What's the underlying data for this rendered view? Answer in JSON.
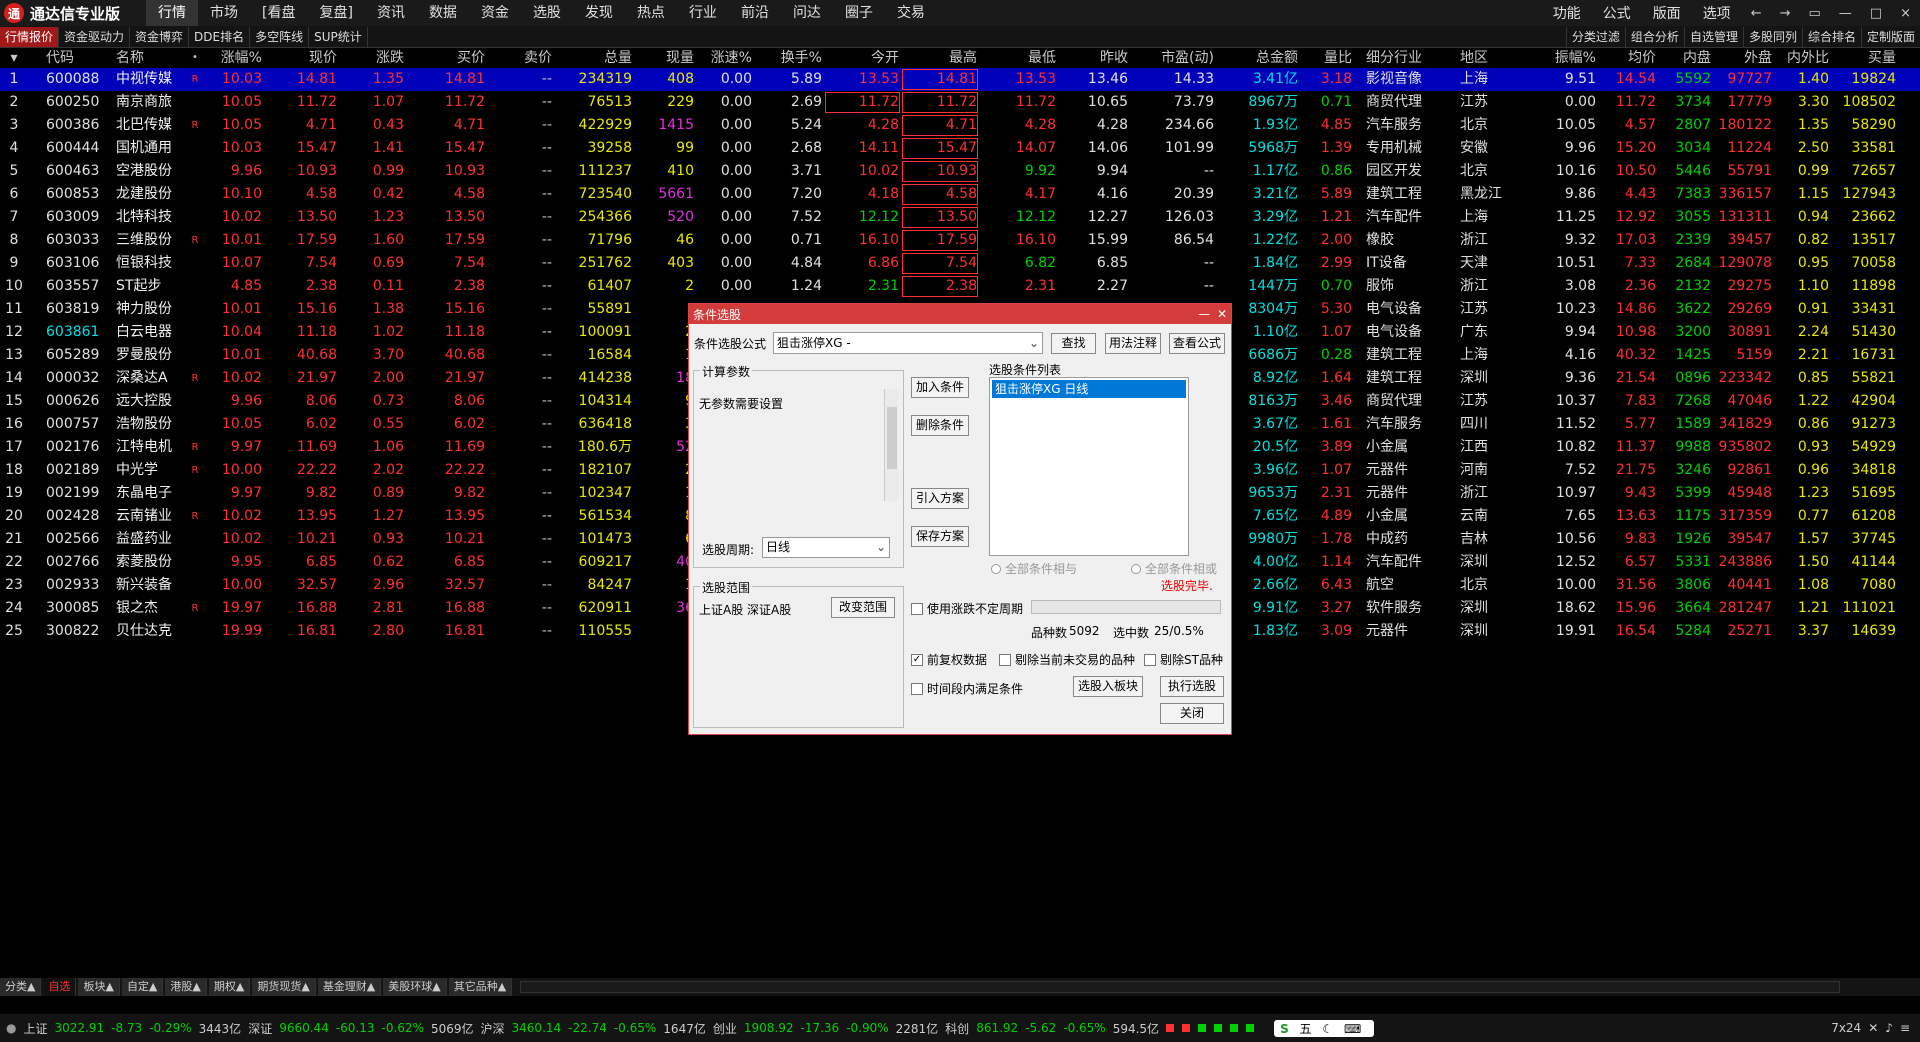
{
  "app": {
    "title": "通达信专业版",
    "logo_char": "通"
  },
  "menu": [
    "行情",
    "市场",
    "[看盘",
    "复盘]",
    "资讯",
    "数据",
    "资金",
    "选股",
    "发现",
    "热点",
    "行业",
    "前沿",
    "问达",
    "圈子",
    "交易"
  ],
  "menu_active": 0,
  "top_right": [
    "功能",
    "公式",
    "版面",
    "选项"
  ],
  "window_controls": [
    "←",
    "→",
    "▭",
    "—",
    "□",
    "×"
  ],
  "subtabs_left": [
    "行情报价",
    "资金驱动力",
    "资金博弈",
    "DDE排名",
    "多空阵线",
    "SUP统计"
  ],
  "subtabs_right": [
    "分类过滤",
    "组合分析",
    "自选管理",
    "多股同列",
    "综合排名",
    "定制版面"
  ],
  "columns": [
    "",
    "代码",
    "名称",
    "•",
    "涨幅%",
    "现价",
    "涨跌",
    "买价",
    "卖价",
    "总量",
    "现量",
    "涨速%",
    "换手%",
    "今开",
    "最高",
    "最低",
    "昨收",
    "市盈(动)",
    "总金额",
    "量比",
    "细分行业",
    "地区",
    "振幅%",
    "均价",
    "内盘",
    "外盘",
    "内外比",
    "买量"
  ],
  "rows": [
    {
      "idx": "1",
      "code": "600088",
      "name": "中视传媒",
      "flag": "R",
      "pct": "10.03",
      "price": "14.81",
      "chg": "1.35",
      "bid": "14.81",
      "ask": "--",
      "vol": "234319",
      "cur": "408",
      "spd": "0.00",
      "turn": "5.89",
      "open": "13.53",
      "high": "14.81",
      "low": "13.53",
      "prev": "13.46",
      "pe": "14.33",
      "amt": "3.41亿",
      "vr": "3.18",
      "ind": "影视音像",
      "reg": "上海",
      "amp": "9.51",
      "avg": "14.54",
      "in": "5592",
      "out": "97727",
      "io": "1.40",
      "buy": "19824"
    },
    {
      "idx": "2",
      "code": "600250",
      "name": "南京商旅",
      "flag": "",
      "pct": "10.05",
      "price": "11.72",
      "chg": "1.07",
      "bid": "11.72",
      "ask": "--",
      "vol": "76513",
      "cur": "229",
      "spd": "0.00",
      "turn": "2.69",
      "open": "11.72",
      "high": "11.72",
      "low": "11.72",
      "prev": "10.65",
      "pe": "73.79",
      "amt": "8967万",
      "vr": "0.71",
      "ind": "商贸代理",
      "reg": "江苏",
      "amp": "0.00",
      "avg": "11.72",
      "in": "3734",
      "out": "17779",
      "io": "3.30",
      "buy": "108502"
    },
    {
      "idx": "3",
      "code": "600386",
      "name": "北巴传媒",
      "flag": "R",
      "pct": "10.05",
      "price": "4.71",
      "chg": "0.43",
      "bid": "4.71",
      "ask": "--",
      "vol": "422929",
      "cur": "1415",
      "spd": "0.00",
      "turn": "5.24",
      "open": "4.28",
      "high": "4.71",
      "low": "4.28",
      "prev": "4.28",
      "pe": "234.66",
      "amt": "1.93亿",
      "vr": "4.85",
      "ind": "汽车服务",
      "reg": "北京",
      "amp": "10.05",
      "avg": "4.57",
      "in": "2807",
      "out": "180122",
      "io": "1.35",
      "buy": "58290"
    },
    {
      "idx": "4",
      "code": "600444",
      "name": "国机通用",
      "flag": "",
      "pct": "10.03",
      "price": "15.47",
      "chg": "1.41",
      "bid": "15.47",
      "ask": "--",
      "vol": "39258",
      "cur": "99",
      "spd": "0.00",
      "turn": "2.68",
      "open": "14.11",
      "high": "15.47",
      "low": "14.07",
      "prev": "14.06",
      "pe": "101.99",
      "amt": "5968万",
      "vr": "1.39",
      "ind": "专用机械",
      "reg": "安徽",
      "amp": "9.96",
      "avg": "15.20",
      "in": "3034",
      "out": "11224",
      "io": "2.50",
      "buy": "33581"
    },
    {
      "idx": "5",
      "code": "600463",
      "name": "空港股份",
      "flag": "",
      "pct": "9.96",
      "price": "10.93",
      "chg": "0.99",
      "bid": "10.93",
      "ask": "--",
      "vol": "111237",
      "cur": "410",
      "spd": "0.00",
      "turn": "3.71",
      "open": "10.02",
      "high": "10.93",
      "low": "9.92",
      "prev": "9.94",
      "pe": "--",
      "amt": "1.17亿",
      "vr": "0.86",
      "ind": "园区开发",
      "reg": "北京",
      "amp": "10.16",
      "avg": "10.50",
      "in": "5446",
      "out": "55791",
      "io": "0.99",
      "buy": "72657"
    },
    {
      "idx": "6",
      "code": "600853",
      "name": "龙建股份",
      "flag": "",
      "pct": "10.10",
      "price": "4.58",
      "chg": "0.42",
      "bid": "4.58",
      "ask": "--",
      "vol": "723540",
      "cur": "5661",
      "spd": "0.00",
      "turn": "7.20",
      "open": "4.18",
      "high": "4.58",
      "low": "4.17",
      "prev": "4.16",
      "pe": "20.39",
      "amt": "3.21亿",
      "vr": "5.89",
      "ind": "建筑工程",
      "reg": "黑龙江",
      "amp": "9.86",
      "avg": "4.43",
      "in": "7383",
      "out": "336157",
      "io": "1.15",
      "buy": "127943"
    },
    {
      "idx": "7",
      "code": "603009",
      "name": "北特科技",
      "flag": "",
      "pct": "10.02",
      "price": "13.50",
      "chg": "1.23",
      "bid": "13.50",
      "ask": "--",
      "vol": "254366",
      "cur": "520",
      "spd": "0.00",
      "turn": "7.52",
      "open": "12.12",
      "high": "13.50",
      "low": "12.12",
      "prev": "12.27",
      "pe": "126.03",
      "amt": "3.29亿",
      "vr": "1.21",
      "ind": "汽车配件",
      "reg": "上海",
      "amp": "11.25",
      "avg": "12.92",
      "in": "3055",
      "out": "131311",
      "io": "0.94",
      "buy": "23662"
    },
    {
      "idx": "8",
      "code": "603033",
      "name": "三维股份",
      "flag": "R",
      "pct": "10.01",
      "price": "17.59",
      "chg": "1.60",
      "bid": "17.59",
      "ask": "--",
      "vol": "71796",
      "cur": "46",
      "spd": "0.00",
      "turn": "0.71",
      "open": "16.10",
      "high": "17.59",
      "low": "16.10",
      "prev": "15.99",
      "pe": "86.54",
      "amt": "1.22亿",
      "vr": "2.00",
      "ind": "橡胶",
      "reg": "浙江",
      "amp": "9.32",
      "avg": "17.03",
      "in": "2339",
      "out": "39457",
      "io": "0.82",
      "buy": "13517"
    },
    {
      "idx": "9",
      "code": "603106",
      "name": "恒银科技",
      "flag": "",
      "pct": "10.07",
      "price": "7.54",
      "chg": "0.69",
      "bid": "7.54",
      "ask": "--",
      "vol": "251762",
      "cur": "403",
      "spd": "0.00",
      "turn": "4.84",
      "open": "6.86",
      "high": "7.54",
      "low": "6.82",
      "prev": "6.85",
      "pe": "--",
      "amt": "1.84亿",
      "vr": "2.99",
      "ind": "IT设备",
      "reg": "天津",
      "amp": "10.51",
      "avg": "7.33",
      "in": "2684",
      "out": "129078",
      "io": "0.95",
      "buy": "70058"
    },
    {
      "idx": "10",
      "code": "603557",
      "name": "ST起步",
      "flag": "",
      "pct": "4.85",
      "price": "2.38",
      "chg": "0.11",
      "bid": "2.38",
      "ask": "--",
      "vol": "61407",
      "cur": "2",
      "spd": "0.00",
      "turn": "1.24",
      "open": "2.31",
      "high": "2.38",
      "low": "2.31",
      "prev": "2.27",
      "pe": "--",
      "amt": "1447万",
      "vr": "0.70",
      "ind": "服饰",
      "reg": "浙江",
      "amp": "3.08",
      "avg": "2.36",
      "in": "2132",
      "out": "29275",
      "io": "1.10",
      "buy": "11898"
    },
    {
      "idx": "11",
      "code": "603819",
      "name": "神力股份",
      "flag": "",
      "pct": "10.01",
      "price": "15.16",
      "chg": "1.38",
      "bid": "15.16",
      "ask": "--",
      "vol": "55891",
      "cur": "",
      "spd": "",
      "turn": "",
      "open": "",
      "high": "",
      "low": "",
      "prev": "",
      "pe": "",
      "amt": "8304万",
      "vr": "5.30",
      "ind": "电气设备",
      "reg": "江苏",
      "amp": "10.23",
      "avg": "14.86",
      "in": "3622",
      "out": "29269",
      "io": "0.91",
      "buy": "33431"
    },
    {
      "idx": "12",
      "code": "603861",
      "name": "白云电器",
      "flag": "",
      "pct": "10.04",
      "price": "11.18",
      "chg": "1.02",
      "bid": "11.18",
      "ask": "--",
      "vol": "100091",
      "cur": "2",
      "spd": "",
      "turn": "",
      "open": "",
      "high": "",
      "low": "",
      "prev": "",
      "pe": "",
      "amt": "1.10亿",
      "vr": "1.07",
      "ind": "电气设备",
      "reg": "广东",
      "amp": "9.94",
      "avg": "10.98",
      "in": "3200",
      "out": "30891",
      "io": "2.24",
      "buy": "51430"
    },
    {
      "idx": "13",
      "code": "605289",
      "name": "罗曼股份",
      "flag": "",
      "pct": "10.01",
      "price": "40.68",
      "chg": "3.70",
      "bid": "40.68",
      "ask": "--",
      "vol": "16584",
      "cur": "1",
      "spd": "",
      "turn": "",
      "open": "",
      "high": "",
      "low": "",
      "prev": "",
      "pe": "",
      "amt": "6686万",
      "vr": "0.28",
      "ind": "建筑工程",
      "reg": "上海",
      "amp": "4.16",
      "avg": "40.32",
      "in": "1425",
      "out": "5159",
      "io": "2.21",
      "buy": "16731"
    },
    {
      "idx": "14",
      "code": "000032",
      "name": "深桑达A",
      "flag": "R",
      "pct": "10.02",
      "price": "21.97",
      "chg": "2.00",
      "bid": "21.97",
      "ask": "--",
      "vol": "414238",
      "cur": "18",
      "spd": "",
      "turn": "",
      "open": "",
      "high": "",
      "low": "",
      "prev": "",
      "pe": "",
      "amt": "8.92亿",
      "vr": "1.64",
      "ind": "建筑工程",
      "reg": "深圳",
      "amp": "9.36",
      "avg": "21.54",
      "in": "0896",
      "out": "223342",
      "io": "0.85",
      "buy": "55821"
    },
    {
      "idx": "15",
      "code": "000626",
      "name": "远大控股",
      "flag": "",
      "pct": "9.96",
      "price": "8.06",
      "chg": "0.73",
      "bid": "8.06",
      "ask": "--",
      "vol": "104314",
      "cur": "9",
      "spd": "",
      "turn": "",
      "open": "",
      "high": "",
      "low": "",
      "prev": "",
      "pe": "",
      "amt": "8163万",
      "vr": "3.46",
      "ind": "商贸代理",
      "reg": "江苏",
      "amp": "10.37",
      "avg": "7.83",
      "in": "7268",
      "out": "47046",
      "io": "1.22",
      "buy": "42904"
    },
    {
      "idx": "16",
      "code": "000757",
      "name": "浩物股份",
      "flag": "",
      "pct": "10.05",
      "price": "6.02",
      "chg": "0.55",
      "bid": "6.02",
      "ask": "--",
      "vol": "636418",
      "cur": "3",
      "spd": "",
      "turn": "",
      "open": "",
      "high": "",
      "low": "",
      "prev": "",
      "pe": "",
      "amt": "3.67亿",
      "vr": "1.61",
      "ind": "汽车服务",
      "reg": "四川",
      "amp": "11.52",
      "avg": "5.77",
      "in": "1589",
      "out": "341829",
      "io": "0.86",
      "buy": "91273"
    },
    {
      "idx": "17",
      "code": "002176",
      "name": "江特电机",
      "flag": "R",
      "pct": "9.97",
      "price": "11.69",
      "chg": "1.06",
      "bid": "11.69",
      "ask": "--",
      "vol": "180.6万",
      "cur": "52",
      "spd": "",
      "turn": "",
      "open": "",
      "high": "",
      "low": "",
      "prev": "",
      "pe": "",
      "amt": "20.5亿",
      "vr": "3.89",
      "ind": "小金属",
      "reg": "江西",
      "amp": "10.82",
      "avg": "11.37",
      "in": "9988",
      "out": "935802",
      "io": "0.93",
      "buy": "54929"
    },
    {
      "idx": "18",
      "code": "002189",
      "name": "中光学",
      "flag": "R",
      "pct": "10.00",
      "price": "22.22",
      "chg": "2.02",
      "bid": "22.22",
      "ask": "--",
      "vol": "182107",
      "cur": "2",
      "spd": "",
      "turn": "",
      "open": "",
      "high": "",
      "low": "",
      "prev": "",
      "pe": "",
      "amt": "3.96亿",
      "vr": "1.07",
      "ind": "元器件",
      "reg": "河南",
      "amp": "7.52",
      "avg": "21.75",
      "in": "3246",
      "out": "92861",
      "io": "0.96",
      "buy": "34818"
    },
    {
      "idx": "19",
      "code": "002199",
      "name": "东晶电子",
      "flag": "",
      "pct": "9.97",
      "price": "9.82",
      "chg": "0.89",
      "bid": "9.82",
      "ask": "--",
      "vol": "102347",
      "cur": "1",
      "spd": "",
      "turn": "",
      "open": "",
      "high": "",
      "low": "",
      "prev": "",
      "pe": "",
      "amt": "9653万",
      "vr": "2.31",
      "ind": "元器件",
      "reg": "浙江",
      "amp": "10.97",
      "avg": "9.43",
      "in": "5399",
      "out": "45948",
      "io": "1.23",
      "buy": "51695"
    },
    {
      "idx": "20",
      "code": "002428",
      "name": "云南锗业",
      "flag": "R",
      "pct": "10.02",
      "price": "13.95",
      "chg": "1.27",
      "bid": "13.95",
      "ask": "--",
      "vol": "561534",
      "cur": "8",
      "spd": "",
      "turn": "",
      "open": "",
      "high": "",
      "low": "",
      "prev": "",
      "pe": "",
      "amt": "7.65亿",
      "vr": "4.89",
      "ind": "小金属",
      "reg": "云南",
      "amp": "7.65",
      "avg": "13.63",
      "in": "1175",
      "out": "317359",
      "io": "0.77",
      "buy": "61208"
    },
    {
      "idx": "21",
      "code": "002566",
      "name": "益盛药业",
      "flag": "",
      "pct": "10.02",
      "price": "10.21",
      "chg": "0.93",
      "bid": "10.21",
      "ask": "--",
      "vol": "101473",
      "cur": "6",
      "spd": "",
      "turn": "",
      "open": "",
      "high": "",
      "low": "",
      "prev": "",
      "pe": "",
      "amt": "9980万",
      "vr": "1.78",
      "ind": "中成药",
      "reg": "吉林",
      "amp": "10.56",
      "avg": "9.83",
      "in": "1926",
      "out": "39547",
      "io": "1.57",
      "buy": "37745"
    },
    {
      "idx": "22",
      "code": "002766",
      "name": "索菱股份",
      "flag": "",
      "pct": "9.95",
      "price": "6.85",
      "chg": "0.62",
      "bid": "6.85",
      "ask": "--",
      "vol": "609217",
      "cur": "40",
      "spd": "",
      "turn": "",
      "open": "",
      "high": "",
      "low": "",
      "prev": "",
      "pe": "",
      "amt": "4.00亿",
      "vr": "1.14",
      "ind": "汽车配件",
      "reg": "深圳",
      "amp": "12.52",
      "avg": "6.57",
      "in": "5331",
      "out": "243886",
      "io": "1.50",
      "buy": "41144"
    },
    {
      "idx": "23",
      "code": "002933",
      "name": "新兴装备",
      "flag": "",
      "pct": "10.00",
      "price": "32.57",
      "chg": "2.96",
      "bid": "32.57",
      "ask": "--",
      "vol": "84247",
      "cur": "1",
      "spd": "",
      "turn": "",
      "open": "",
      "high": "",
      "low": "",
      "prev": "",
      "pe": "",
      "amt": "2.66亿",
      "vr": "6.43",
      "ind": "航空",
      "reg": "北京",
      "amp": "10.00",
      "avg": "31.56",
      "in": "3806",
      "out": "40441",
      "io": "1.08",
      "buy": "7080"
    },
    {
      "idx": "24",
      "code": "300085",
      "name": "银之杰",
      "flag": "R",
      "pct": "19.97",
      "price": "16.88",
      "chg": "2.81",
      "bid": "16.88",
      "ask": "--",
      "vol": "620911",
      "cur": "36",
      "spd": "",
      "turn": "",
      "open": "",
      "high": "",
      "low": "",
      "prev": "",
      "pe": "",
      "amt": "9.91亿",
      "vr": "3.27",
      "ind": "软件服务",
      "reg": "深圳",
      "amp": "18.62",
      "avg": "15.96",
      "in": "3664",
      "out": "281247",
      "io": "1.21",
      "buy": "111021"
    },
    {
      "idx": "25",
      "code": "300822",
      "name": "贝仕达克",
      "flag": "",
      "pct": "19.99",
      "price": "16.81",
      "chg": "2.80",
      "bid": "16.81",
      "ask": "--",
      "vol": "110555",
      "cur": "",
      "spd": "",
      "turn": "",
      "open": "",
      "high": "",
      "low": "",
      "prev": "",
      "pe": "",
      "amt": "1.83亿",
      "vr": "3.09",
      "ind": "元器件",
      "reg": "深圳",
      "amp": "19.91",
      "avg": "16.54",
      "in": "5284",
      "out": "25271",
      "io": "3.37",
      "buy": "14639"
    }
  ],
  "bottom_tabs": [
    "分类▲",
    "自选",
    "板块▲",
    "自定▲",
    "港股▲",
    "期权▲",
    "期货现货▲",
    "基金理财▲",
    "美股环球▲",
    "其它品种▲"
  ],
  "status": {
    "sh_label": "上证",
    "sh_val": "3022.91",
    "sh_chg": "-8.73",
    "sh_pct": "-0.29%",
    "sh_amt": "3443亿",
    "sz_label": "深证",
    "sz_val": "9660.44",
    "sz_chg": "-60.13",
    "sz_pct": "-0.62%",
    "sz_amt": "5069亿",
    "hs_label": "沪深",
    "hs_val": "3460.14",
    "hs_chg": "-22.74",
    "hs_pct": "-0.65%",
    "hs_amt": "1647亿",
    "cy_label": "创业",
    "cy_val": "1908.92",
    "cy_chg": "-17.36",
    "cy_pct": "-0.90%",
    "cy_amt": "2281亿",
    "kc_label": "科创",
    "kc_val": "861.92",
    "kc_chg": "-5.62",
    "kc_pct": "-0.65%",
    "kc_amt": "594.5亿",
    "ime": "五",
    "hours": "7x24"
  },
  "dialog": {
    "title": "条件选股",
    "formula_label": "条件选股公式",
    "formula_value": "狙击涨停XG  -",
    "btn_find": "查找",
    "btn_usage": "用法注释",
    "btn_view": "查看公式",
    "calc_group": "计算参数",
    "calc_text": "无参数需要设置",
    "period_label": "选股周期:",
    "period_value": "日线",
    "btn_add": "加入条件",
    "btn_delete": "删除条件",
    "btn_import": "引入方案",
    "btn_save": "保存方案",
    "list_label": "选股条件列表",
    "list_item": "狙击涨停XG  日线",
    "radio_and": "全部条件相与",
    "radio_or": "全部条件相或",
    "done_text": "选股完毕.",
    "range_group": "选股范围",
    "range_text": "上证A股 深证A股",
    "btn_change": "改变范围",
    "chk_uncertain": "使用涨跌不定周期",
    "count_label": "品种数",
    "count_value": "5092",
    "selected_label": "选中数",
    "selected_value": "25/0.5%",
    "chk_fuquan": "前复权数据",
    "chk_remove_untraded": "剔除当前未交易的品种",
    "chk_remove_st": "剔除ST品种",
    "chk_period": "时间段内满足条件",
    "btn_to_block": "选股入板块",
    "btn_execute": "执行选股",
    "btn_close": "关闭"
  }
}
